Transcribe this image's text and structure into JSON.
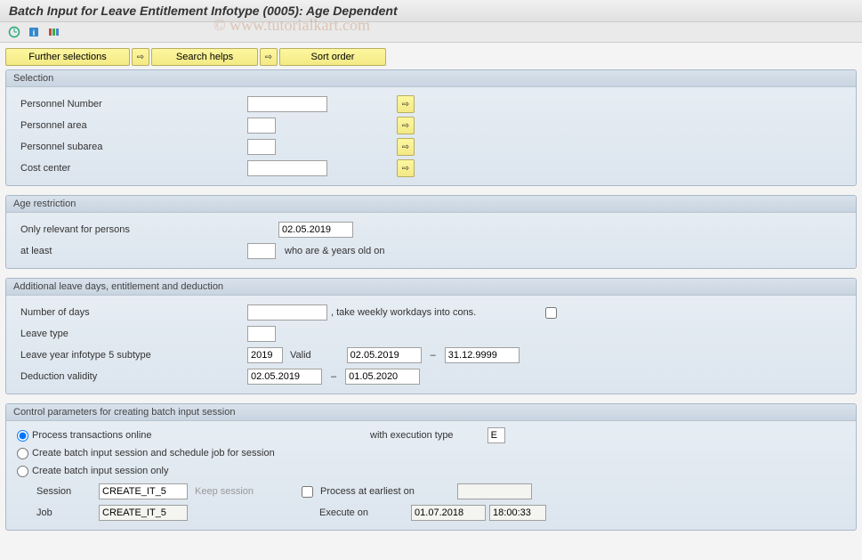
{
  "title": "Batch Input for Leave Entitlement Infotype (0005): Age Dependent",
  "watermark": "© www.tutorialkart.com",
  "buttons": {
    "further_selections": "Further selections",
    "search_helps": "Search helps",
    "sort_order": "Sort order"
  },
  "selection": {
    "title": "Selection",
    "personnel_number": "Personnel Number",
    "personnel_area": "Personnel area",
    "personnel_subarea": "Personnel subarea",
    "cost_center": "Cost center"
  },
  "age": {
    "title": "Age restriction",
    "only_relevant": "Only relevant for persons",
    "date": "02.05.2019",
    "at_least": "  at least",
    "who_are": "who are & years old on"
  },
  "additional": {
    "title": "Additional leave days, entitlement and deduction",
    "number_of_days": "Number of days",
    "take_weekly": ", take weekly workdays into cons.",
    "leave_type": "Leave type",
    "leave_year": "Leave year infotype 5 subtype",
    "year": "2019",
    "valid": "Valid",
    "valid_from": "02.05.2019",
    "dash": "–",
    "valid_to": "31.12.9999",
    "deduction_validity": "Deduction validity",
    "ded_from": "02.05.2019",
    "ded_to": "01.05.2020"
  },
  "control": {
    "title": "Control parameters for creating batch input session",
    "opt1": "Process transactions online",
    "with_exec": "with execution type",
    "exec_type": "E",
    "opt2": "Create batch input session and schedule job for session",
    "opt3": "Create batch input session only",
    "session_label": "Session",
    "session_value": "CREATE_IT_5",
    "keep_session": "Keep session",
    "process_earliest": "Process at earliest on",
    "job_label": "Job",
    "job_value": "CREATE_IT_5",
    "execute_on": "Execute on",
    "exec_date": "01.07.2018",
    "exec_time": "18:00:33"
  }
}
